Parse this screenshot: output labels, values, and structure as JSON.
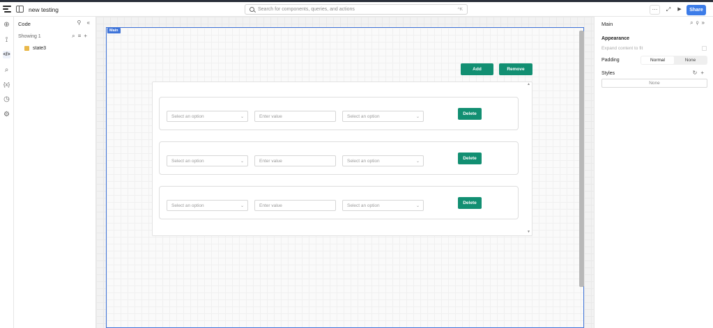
{
  "app": {
    "title": "new testing"
  },
  "search": {
    "placeholder": "Search for components, queries, and actions",
    "shortcut": "^K"
  },
  "toolbar": {
    "more": "···",
    "expand": "⤢",
    "play": "▶",
    "share_label": "Share"
  },
  "left_panel": {
    "title": "Code",
    "showing_label": "Showing 1",
    "items": [
      {
        "label": "state3",
        "icon": "state-icon"
      }
    ]
  },
  "canvas": {
    "frame_label": "Main",
    "add_label": "Add",
    "remove_label": "Remove",
    "rows": [
      {
        "select1": "Select an option",
        "input": "Enter value",
        "select2": "Select an option",
        "delete_label": "Delete"
      },
      {
        "select1": "Select an option",
        "input": "Enter value",
        "select2": "Select an option",
        "delete_label": "Delete"
      },
      {
        "select1": "Select an option",
        "input": "Enter value",
        "select2": "Select an option",
        "delete_label": "Delete"
      }
    ]
  },
  "right_panel": {
    "title": "Main",
    "appearance_label": "Appearance",
    "expand_label": "Expand content to fit",
    "padding_label": "Padding",
    "padding_options": [
      "Normal",
      "None"
    ],
    "styles_label": "Styles",
    "styles_value": "None"
  },
  "colors": {
    "accent": "#3c7ce8",
    "button_green": "#128f72",
    "frame_blue": "#3f74d9"
  }
}
